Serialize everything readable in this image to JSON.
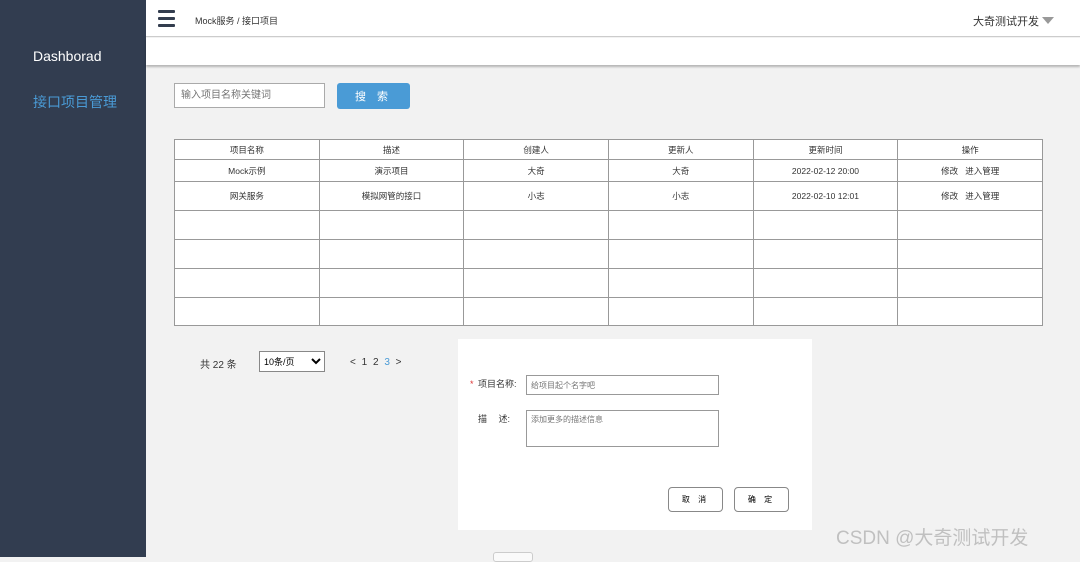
{
  "sidebar": {
    "items": [
      {
        "label": "Dashborad",
        "active": false
      },
      {
        "label": "接口项目管理",
        "active": true
      }
    ],
    "accent": "#4a9bd6"
  },
  "header": {
    "breadcrumb": "Mock服务 / 接口项目",
    "user": "大奇测试开发",
    "menu_icon": "hamburger-icon",
    "user_dropdown_icon": "caret-down-icon"
  },
  "search": {
    "placeholder": "输入项目名称关键词",
    "value": "",
    "button_label": "搜 索"
  },
  "table": {
    "columns": [
      "项目名称",
      "描述",
      "创建人",
      "更新人",
      "更新时间",
      "操作"
    ],
    "rows": [
      [
        "Mock示例",
        "演示项目",
        "大奇",
        "大奇",
        "2022-02-12 20:00"
      ],
      [
        "网关服务",
        "模拟网管的接口",
        "小志",
        "小志",
        "2022-02-10 12:01"
      ]
    ],
    "actions": {
      "edit": "修改",
      "enter": "进入管理"
    }
  },
  "pagination": {
    "total": "共 22 条",
    "page_size": "10条/页",
    "prev": "<",
    "pages": [
      "1",
      "2",
      "3"
    ],
    "current": "3",
    "next": ">"
  },
  "dialog": {
    "name_label": "项目名称:",
    "required_mark": "*",
    "name_placeholder": "给项目起个名字吧",
    "desc_label": "描　 述:",
    "desc_placeholder": "添加更多的描述信息",
    "cancel": "取 消",
    "confirm": "确 定"
  },
  "watermark": "CSDN @大奇测试开发"
}
